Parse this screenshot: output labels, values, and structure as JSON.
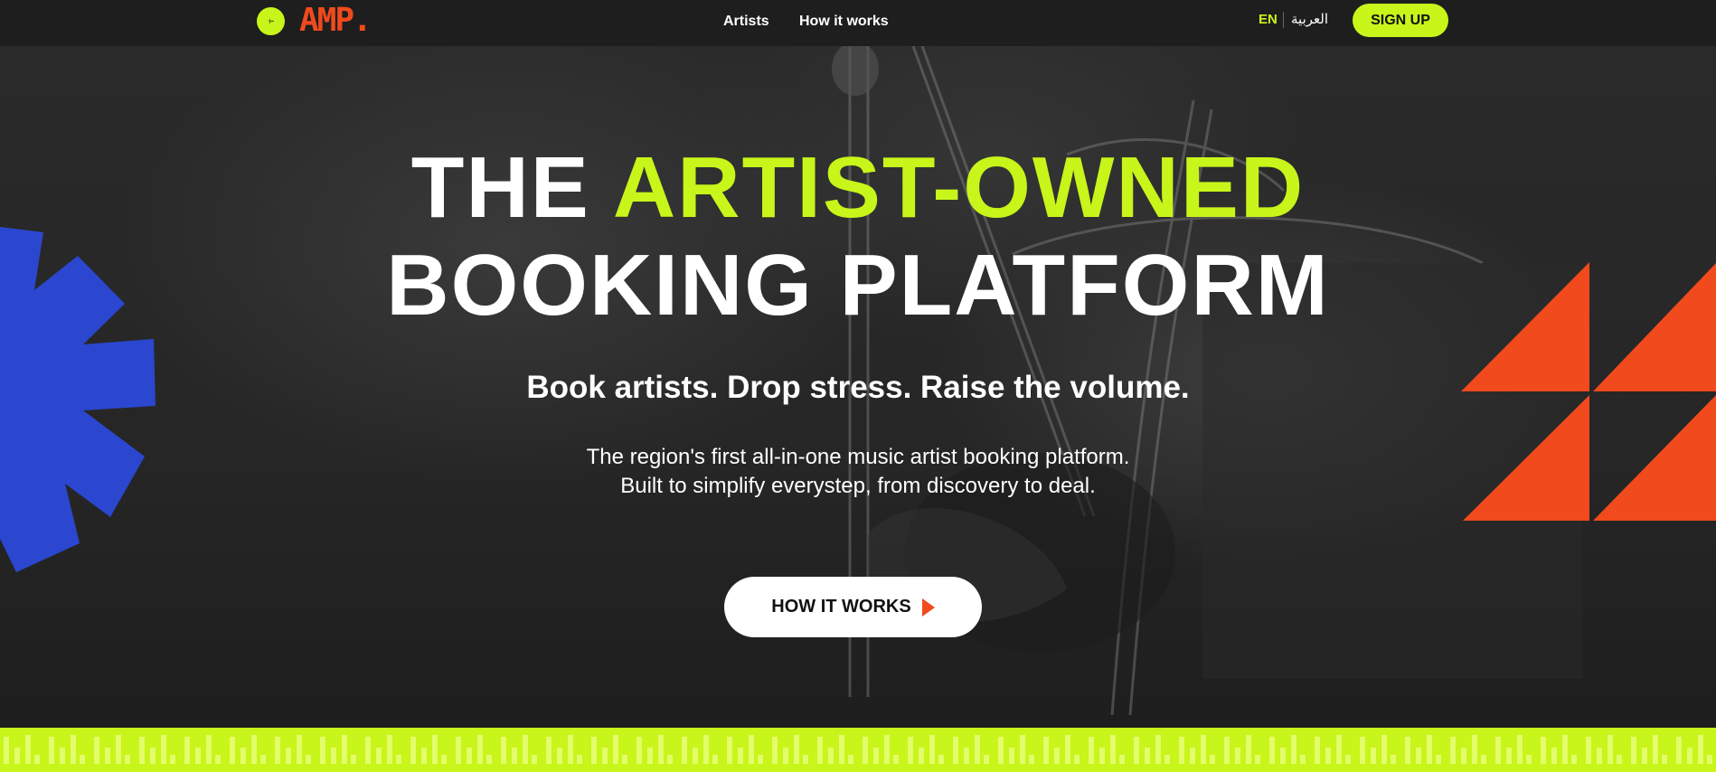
{
  "brand": {
    "logo_text": "AMP.",
    "logo_dot_text": "·|▪▪",
    "logo_color": "#f04a1d",
    "accent_color": "#c8f51a"
  },
  "nav": {
    "links": [
      "Artists",
      "How it works"
    ],
    "lang_active": "EN",
    "lang_alt": "العربية",
    "signup_label": "SIGN UP"
  },
  "hero": {
    "title_line1_plain": "THE ",
    "title_line1_accent": "ARTIST-OWNED",
    "title_line2": "BOOKING PLATFORM",
    "tagline": "Book artists. Drop stress. Raise the volume.",
    "description": [
      "The region's first all-in-one music artist booking platform.",
      "Built to simplify everystep, from discovery to deal."
    ],
    "cta_label": "HOW IT WORKS",
    "cta_icon": "play-triangle-icon",
    "decor_colors": {
      "blue_shape": "#2b47cf",
      "orange_shape": "#f04a1d"
    }
  }
}
